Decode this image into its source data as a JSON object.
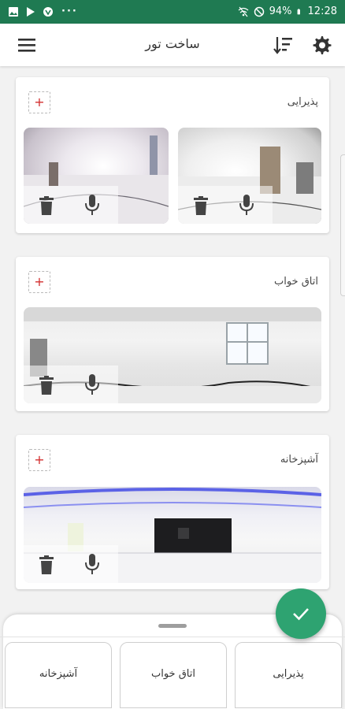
{
  "status_bar": {
    "battery": "94%",
    "time": "12:28",
    "dots": "···",
    "left_icons": [
      "image-icon",
      "play-store-icon",
      "vpn-icon"
    ],
    "right_icons": [
      "wifi-off-icon",
      "block-icon",
      "battery-icon"
    ]
  },
  "toolbar": {
    "title": "ساخت تور",
    "menu_icon": "hamburger-menu-icon",
    "sort_icon": "sort-icon",
    "settings_icon": "gear-icon"
  },
  "rooms": [
    {
      "title": "پذیرایی",
      "add_label": "+",
      "photo_count": 2
    },
    {
      "title": "اتاق خواب",
      "add_label": "+",
      "photo_count": 1
    },
    {
      "title": "آشپزخانه",
      "add_label": "+",
      "photo_count": 1
    }
  ],
  "photo_controls": {
    "delete_icon": "trash-icon",
    "audio_icon": "mic-icon"
  },
  "bottom_sheet": {
    "handle_icon": "drag-handle-icon",
    "room_chips": [
      "پذیرایی",
      "اتاق خواب",
      "آشپزخانه"
    ]
  },
  "fab": {
    "icon": "check-icon"
  },
  "colors": {
    "status_bar": "#1f7a52",
    "accent": "#2ea371",
    "add_red": "#d32f2f"
  }
}
